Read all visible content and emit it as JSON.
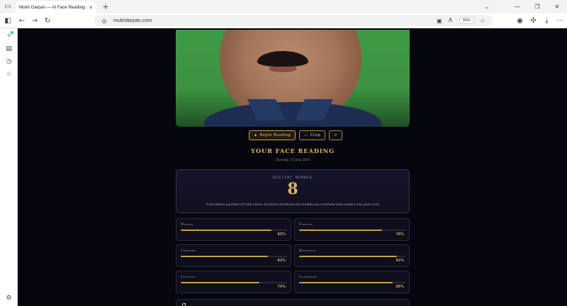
{
  "browser": {
    "tab_title": "Mukh Darpan — AI Face Reading | M",
    "url": "mukhdarpan.com",
    "zoom": "90%"
  },
  "actions": {
    "begin_label": "Begin Reading",
    "crop_label": "Crop",
    "reset_label": "↺"
  },
  "reading": {
    "title": "YOUR FACE READING",
    "date": "Tuesday, 15 July 2025"
  },
  "destiny": {
    "label": "DESTINY NUMBER",
    "number": "8",
    "description": "A disciplined guardian of truth whose structured forehead and resolute jaw command deep respect and quiet trust."
  },
  "traits": [
    {
      "name": "Wisdom",
      "value": 85,
      "value_text": "85%"
    },
    {
      "name": "Fortune",
      "value": 78,
      "value_text": "78%"
    },
    {
      "name": "Charisma",
      "value": 82,
      "value_text": "82%"
    },
    {
      "name": "Resilience",
      "value": 92,
      "value_text": "92%"
    },
    {
      "name": "Intuition",
      "value": 74,
      "value_text": "74%"
    },
    {
      "name": "Leadership",
      "value": 88,
      "value_text": "88%"
    }
  ],
  "colors": {
    "accent_gold": "#c9a04a",
    "page_bg": "#06060f",
    "card_bg": "#0f0e1c"
  }
}
